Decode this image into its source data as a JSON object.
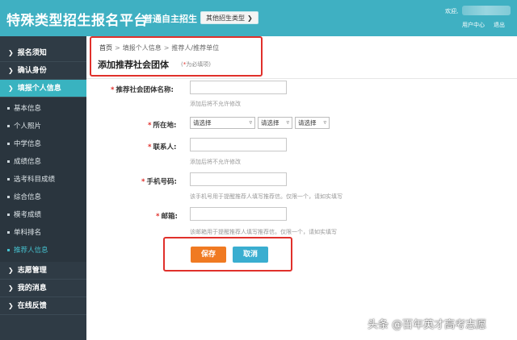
{
  "header": {
    "brand": "特殊类型招生报名平台",
    "mode": "普通自主招生",
    "other_type_label": "其他招生类型",
    "welcome": "欢迎,",
    "user_center": "用户中心",
    "logout": "退出"
  },
  "sidebar": {
    "items": [
      {
        "label": "报名须知"
      },
      {
        "label": "确认身份"
      },
      {
        "label": "填报个人信息"
      }
    ],
    "sub_items": [
      {
        "label": "基本信息"
      },
      {
        "label": "个人照片"
      },
      {
        "label": "中学信息"
      },
      {
        "label": "成绩信息"
      },
      {
        "label": "选考科目成绩"
      },
      {
        "label": "综合信息"
      },
      {
        "label": "模考成绩"
      },
      {
        "label": "单科排名"
      },
      {
        "label": "推荐人信息"
      }
    ],
    "bottom_items": [
      {
        "label": "志愿管理"
      },
      {
        "label": "我的消息"
      },
      {
        "label": "在线反馈"
      }
    ]
  },
  "breadcrumb": {
    "home": "首页",
    "sep": ">",
    "level1": "填报个人信息",
    "level2": "推荐人/推荐单位"
  },
  "page": {
    "title": "添加推荐社会团体",
    "required_star": "*",
    "required_note": "为必填项",
    "required_note_open": "(",
    "required_note_close": ")"
  },
  "form": {
    "org_name": {
      "star": "*",
      "label": "推荐社会团体名称:",
      "value": "",
      "hint": "添加后将不允许修改"
    },
    "location": {
      "star": "*",
      "label": "所在地:",
      "sel1": "请选择",
      "sel2": "请选择",
      "sel3": "请选择"
    },
    "contact": {
      "star": "*",
      "label": "联系人:",
      "value": "",
      "hint": "添加后将不允许修改"
    },
    "phone": {
      "star": "*",
      "label": "手机号码:",
      "value": "",
      "hint": "该手机号用于提醒推荐人填写推荐信。仅限一个，请如实填写"
    },
    "email": {
      "star": "*",
      "label": "邮箱:",
      "value": "",
      "hint": "该邮箱用于提醒推荐人填写推荐信。仅限一个，请如实填写"
    }
  },
  "buttons": {
    "save": "保存",
    "cancel": "取消"
  },
  "watermark": "头条 @百年英才高考志愿",
  "colors": {
    "header": "#3fb0c2",
    "sidebar": "#2f3b45",
    "active": "#39b3c0",
    "save": "#f07a22",
    "cancel": "#3aaed0",
    "highlight": "#e0302b"
  },
  "icons": {
    "nav_arrow": "chevron-right-icon",
    "select_caret": "chevron-down-icon"
  }
}
